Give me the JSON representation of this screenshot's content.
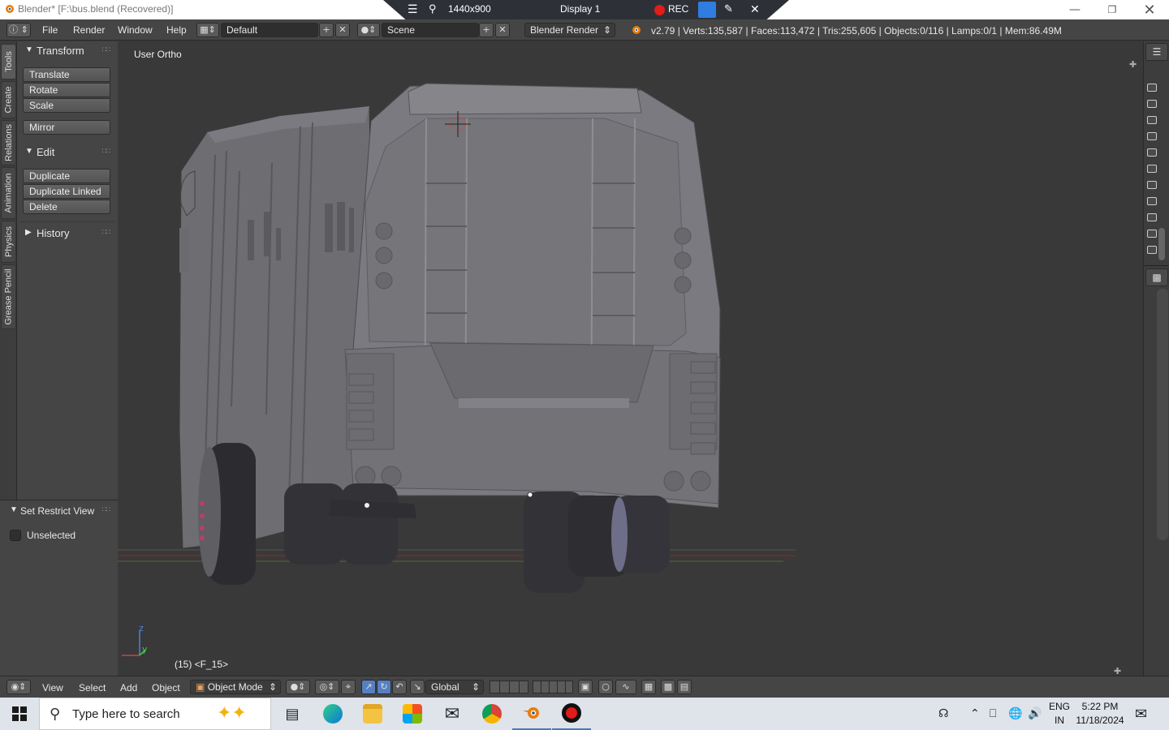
{
  "window": {
    "title": "Blender* [F:\\bus.blend (Recovered)]",
    "minimize_icon": "minimize-icon",
    "restore_icon": "restore-icon",
    "close_icon": "close-icon"
  },
  "recorder": {
    "resolution": "1440x900",
    "display": "Display 1",
    "rec_label": "REC"
  },
  "header": {
    "menus": [
      "File",
      "Render",
      "Window",
      "Help"
    ],
    "layout": "Default",
    "scene": "Scene",
    "engine": "Blender Render",
    "stats": "v2.79 | Verts:135,587 | Faces:113,472 | Tris:255,605 | Objects:0/116 | Lamps:0/1 | Mem:86.49M"
  },
  "tabs": [
    "Tools",
    "Create",
    "Relations",
    "Animation",
    "Physics",
    "Grease Pencil"
  ],
  "toolshelf": {
    "transform": {
      "title": "Transform",
      "buttons": [
        "Translate",
        "Rotate",
        "Scale"
      ],
      "mirror": "Mirror"
    },
    "edit": {
      "title": "Edit",
      "buttons": [
        "Duplicate",
        "Duplicate Linked",
        "Delete"
      ]
    },
    "history": {
      "title": "History"
    }
  },
  "restrict": {
    "title": "Set Restrict View",
    "option": "Unselected",
    "checked": false
  },
  "viewport": {
    "view_label": "User Ortho",
    "frame_label": "(15) <F_15>",
    "axis_z": "z",
    "axis_y": "y"
  },
  "view_header": {
    "menus": [
      "View",
      "Select",
      "Add",
      "Object"
    ],
    "mode": "Object Mode",
    "orientation": "Global"
  },
  "taskbar": {
    "search_placeholder": "Type here to search",
    "apps": [
      "task-view-icon",
      "edge-icon",
      "file-explorer-icon",
      "store-icon",
      "mail-icon",
      "chrome-icon",
      "blender-icon",
      "recorder-icon"
    ],
    "lang_top": "ENG",
    "lang_bottom": "IN",
    "time": "5:22 PM",
    "date": "11/18/2024"
  },
  "colors": {
    "blender_bg": "#393939",
    "panel": "#454545",
    "button": "#5c5c5c",
    "rec_red": "#e21b1b",
    "accent_blue": "#5680c2",
    "taskbar": "#dfe3ea"
  }
}
